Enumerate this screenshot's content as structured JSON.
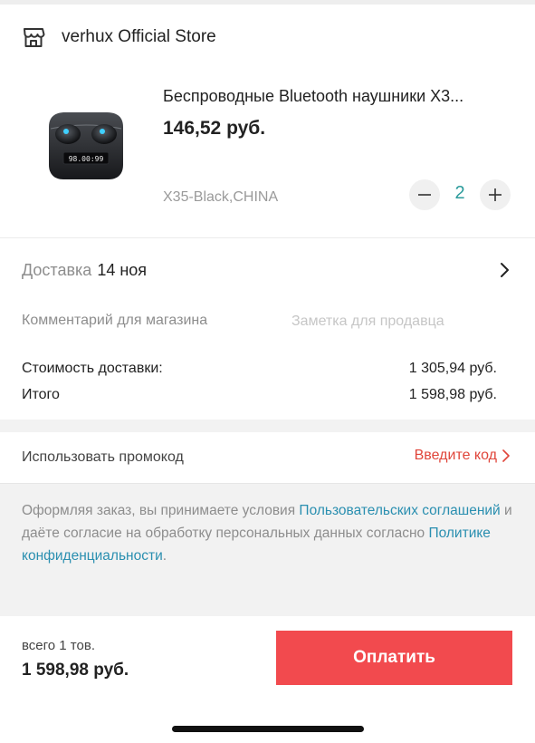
{
  "store": {
    "name": "verhux Official Store",
    "icon": "store-icon"
  },
  "product": {
    "title": "Беспроводные Bluetooth наушники X3...",
    "price": "146,52 руб.",
    "variant": "X35-Black,CHINA",
    "quantity": "2",
    "case_display": "98.00:99"
  },
  "delivery": {
    "label": "Доставка",
    "date": "14 ноя"
  },
  "comment": {
    "label": "Комментарий для магазина",
    "placeholder": "Заметка для продавца"
  },
  "summary": {
    "shipping_label": "Стоимость доставки:",
    "shipping_value": "1 305,94 руб.",
    "total_label": "Итого",
    "total_value": "1 598,98 руб."
  },
  "promo": {
    "label": "Использовать промокод",
    "action": "Введите код"
  },
  "terms": {
    "part1": "Оформляя заказ, вы принимаете условия ",
    "link1": "Пользовательских соглашений",
    "part2": " и даёте согласие на обработку персональных данных согласно ",
    "link2": "Политике конфиденциальности",
    "part3": "."
  },
  "footer": {
    "items_count": "всего 1 тов.",
    "total": "1 598,98 руб.",
    "pay_button": "Оплатить"
  },
  "colors": {
    "accent_red": "#f24a4e",
    "link_blue": "#2a8fb0",
    "quantity_teal": "#2b9b9b",
    "promo_red": "#e0453a"
  }
}
